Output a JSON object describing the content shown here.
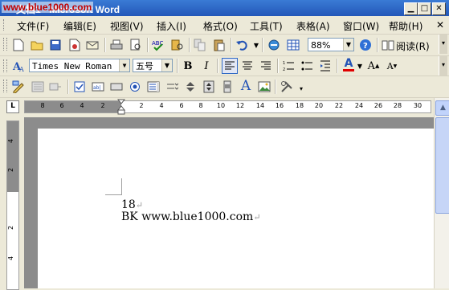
{
  "window": {
    "title": "文档1 - Microsoft Word",
    "watermark": "www.blue1000.com",
    "min_glyph": "▁",
    "max_glyph": "□",
    "close_glyph": "✕"
  },
  "menu": {
    "items": [
      "文件(F)",
      "编辑(E)",
      "视图(V)",
      "插入(I)",
      "格式(O)",
      "工具(T)",
      "表格(A)",
      "窗口(W)",
      "帮助(H)"
    ],
    "close_glyph": "✕"
  },
  "standard_toolbar": {
    "zoom": "88%",
    "read_label": "阅读(R)"
  },
  "formatting_toolbar": {
    "font_name": "Times New Roman",
    "font_size": "五号",
    "bold": "B",
    "italic": "I",
    "font_color": "A",
    "grow_font": "A",
    "shrink_font": "A",
    "font_color_hex": "#e00000"
  },
  "forms_toolbar": {
    "text_tool": "A"
  },
  "ruler": {
    "corner": "L",
    "horizontal_labels": [
      "8",
      "6",
      "4",
      "2",
      "2",
      "4",
      "6",
      "8",
      "10",
      "12",
      "14",
      "16",
      "18",
      "20",
      "22",
      "24",
      "26",
      "28",
      "30"
    ],
    "vertical_labels": [
      "4",
      "2",
      "2",
      "4"
    ]
  },
  "document": {
    "lines": [
      "18",
      "BK www.blue1000.com"
    ],
    "paragraph_mark": "↵"
  },
  "scrollbar": {
    "up": "▲",
    "down": "▼"
  }
}
